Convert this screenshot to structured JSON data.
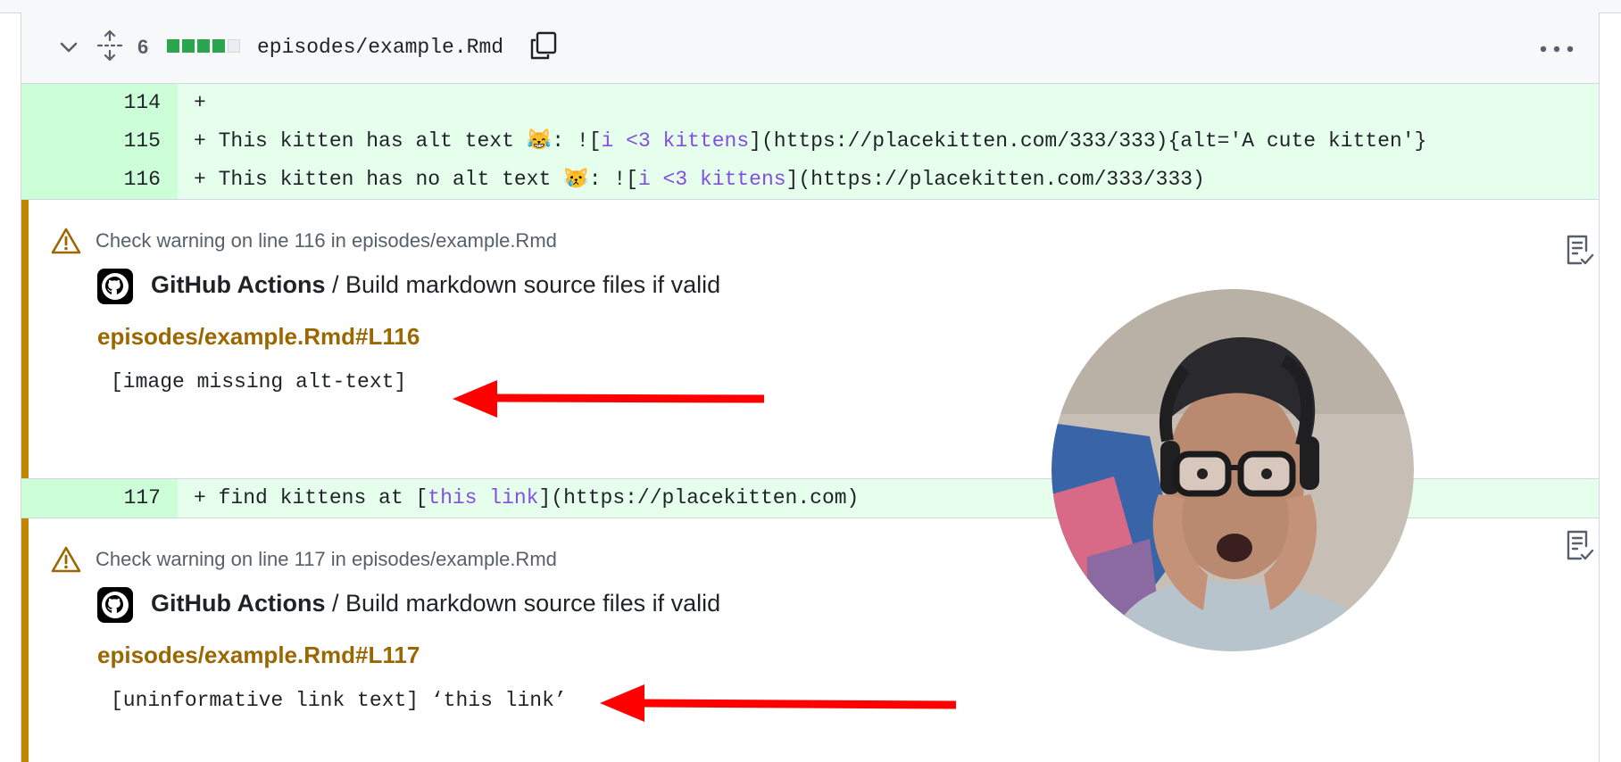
{
  "file": {
    "change_count": "6",
    "filename": "episodes/example.Rmd",
    "diffstat": [
      "added",
      "added",
      "added",
      "added",
      "neutral"
    ]
  },
  "lines": [
    {
      "num": "114",
      "prefix": "+",
      "parts": []
    },
    {
      "num": "115",
      "prefix": "+",
      "parts": [
        {
          "t": " This kitten has alt text 😹: ![",
          "k": false
        },
        {
          "t": "i <3 kittens",
          "k": true
        },
        {
          "t": "](https://placekitten.com/333/333){alt='A cute kitten'}",
          "k": false
        }
      ]
    },
    {
      "num": "116",
      "prefix": "+",
      "parts": [
        {
          "t": " This kitten has no alt text 😿: ![",
          "k": false
        },
        {
          "t": "i <3 kittens",
          "k": true
        },
        {
          "t": "](https://placekitten.com/333/333)",
          "k": false
        }
      ]
    },
    {
      "num": "117",
      "prefix": "+",
      "parts": [
        {
          "t": " find kittens at [",
          "k": false
        },
        {
          "t": "this link",
          "k": true
        },
        {
          "t": "](https://placekitten.com)",
          "k": false
        }
      ]
    }
  ],
  "annotations": [
    {
      "title": "Check warning on line 116 in episodes/example.Rmd",
      "app": "GitHub Actions",
      "job": " / Build markdown source files if valid",
      "location": "episodes/example.Rmd#L116",
      "message": "[image missing alt-text]"
    },
    {
      "title": "Check warning on line 117 in episodes/example.Rmd",
      "app": "GitHub Actions",
      "job": " / Build markdown source files if valid",
      "location": "episodes/example.Rmd#L117",
      "message": "[uninformative link text] ‘this link’"
    }
  ],
  "colors": {
    "added_bg": "#e6ffec",
    "added_num_bg": "#ccffd8",
    "warning": "#bf8700",
    "link_kw": "#8250df",
    "arrow": "#ff0000"
  }
}
